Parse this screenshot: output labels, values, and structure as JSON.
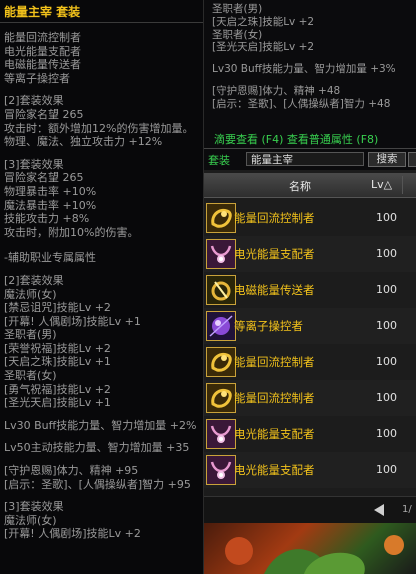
{
  "tooltip": {
    "title": "能量主宰  套装",
    "lines": [
      {
        "text": "能量回流控制者",
        "color": "#9a9a9a",
        "gap": 0
      },
      {
        "text": "电光能量支配者",
        "color": "#9a9a9a",
        "gap": 0
      },
      {
        "text": "电磁能量传送者",
        "color": "#9a9a9a",
        "gap": 0
      },
      {
        "text": "等离子操控者",
        "color": "#9a9a9a",
        "gap": 0
      },
      {
        "text": "[2]套装效果",
        "color": "#9a9a9a",
        "gap": 1
      },
      {
        "text": "冒险家名望 265",
        "color": "#9a9a9a",
        "gap": 0
      },
      {
        "text": "攻击时：额外增加12%的伤害增加量。",
        "color": "#9a9a9a",
        "gap": 0
      },
      {
        "text": "物理、魔法、独立攻击力 +12%",
        "color": "#9a9a9a",
        "gap": 0
      },
      {
        "text": "[3]套装效果",
        "color": "#9a9a9a",
        "gap": 1
      },
      {
        "text": "冒险家名望 265",
        "color": "#9a9a9a",
        "gap": 0
      },
      {
        "text": "物理暴击率 +10%",
        "color": "#9a9a9a",
        "gap": 0
      },
      {
        "text": "魔法暴击率 +10%",
        "color": "#9a9a9a",
        "gap": 0
      },
      {
        "text": "技能攻击力 +8%",
        "color": "#9a9a9a",
        "gap": 0
      },
      {
        "text": "攻击时，附加10%的伤害。",
        "color": "#9a9a9a",
        "gap": 0
      },
      {
        "text": "-辅助职业专属属性",
        "color": "#9a9a9a",
        "gap": 2
      },
      {
        "text": "[2]套装效果",
        "color": "#9a9a9a",
        "gap": 1
      },
      {
        "text": "魔法师(女)",
        "color": "#9a9a9a",
        "gap": 0
      },
      {
        "text": "[禁忌诅咒]技能Lv +2",
        "color": "#9a9a9a",
        "gap": 0
      },
      {
        "text": "[开幕! 人偶剧场]技能Lv +1",
        "color": "#9a9a9a",
        "gap": 0
      },
      {
        "text": "圣职者(男)",
        "color": "#9a9a9a",
        "gap": 0
      },
      {
        "text": "[荣誉祝福]技能Lv +2",
        "color": "#9a9a9a",
        "gap": 0
      },
      {
        "text": "[天启之珠]技能Lv +1",
        "color": "#9a9a9a",
        "gap": 0
      },
      {
        "text": "圣职者(女)",
        "color": "#9a9a9a",
        "gap": 0
      },
      {
        "text": "[勇气祝福]技能Lv +2",
        "color": "#9a9a9a",
        "gap": 0
      },
      {
        "text": "[圣光天启]技能Lv +1",
        "color": "#9a9a9a",
        "gap": 0
      },
      {
        "text": "Lv30 Buff技能力量、智力增加量 +2%",
        "color": "#9a9a9a",
        "gap": 1
      },
      {
        "text": "Lv50主动技能力量、智力增加量 +35",
        "color": "#9a9a9a",
        "gap": 1
      },
      {
        "text": "[守护恩赐]体力、精神 +95",
        "color": "#9a9a9a",
        "gap": 1
      },
      {
        "text": "[启示：圣歌]、[人偶操纵者]智力 +95",
        "color": "#9a9a9a",
        "gap": 0
      },
      {
        "text": "[3]套装效果",
        "color": "#9a9a9a",
        "gap": 1
      },
      {
        "text": "魔法师(女)",
        "color": "#9a9a9a",
        "gap": 0
      },
      {
        "text": "[开幕! 人偶剧场]技能Lv +2",
        "color": "#9a9a9a",
        "gap": 0
      }
    ]
  },
  "right_panel": {
    "lines": [
      {
        "text": "圣职者(男)",
        "gap": 0
      },
      {
        "text": "[天启之珠]技能Lv +2",
        "gap": 0
      },
      {
        "text": "圣职者(女)",
        "gap": 0
      },
      {
        "text": "[圣光天启]技能Lv +2",
        "gap": 0
      },
      {
        "text": "Lv30 Buff技能力量、智力增加量 +3%",
        "gap": 1
      },
      {
        "text": "[守护恩赐]体力、精神 +48",
        "gap": 1
      },
      {
        "text": "[启示：圣歌]、[人偶操纵者]智力 +48",
        "gap": 0
      }
    ],
    "detail_link": "滴要查看 (F4) 查看普通属性 (F8)",
    "set_label": "套装",
    "set_input_value": "能量主宰",
    "search_label": "搜索",
    "list_header": {
      "name": "名称",
      "level": "Lv△"
    },
    "items": [
      {
        "name": "能量回流控制者",
        "level": "100",
        "icon": "gold-bracelet-icon"
      },
      {
        "name": "电光能量支配者",
        "level": "100",
        "icon": "pink-necklace-icon"
      },
      {
        "name": "电磁能量传送者",
        "level": "100",
        "icon": "gold-ring-icon"
      },
      {
        "name": "等离子操控者",
        "level": "100",
        "icon": "purple-orb-icon"
      },
      {
        "name": "能量回流控制者",
        "level": "100",
        "icon": "gold-bracelet-icon"
      },
      {
        "name": "能量回流控制者",
        "level": "100",
        "icon": "gold-bracelet-icon"
      },
      {
        "name": "电光能量支配者",
        "level": "100",
        "icon": "pink-necklace-icon"
      },
      {
        "name": "电光能量支配者",
        "level": "100",
        "icon": "pink-necklace-icon"
      }
    ],
    "page_indicator": "1/"
  },
  "colors": {
    "gold": "#f2c21b",
    "green": "#38d04f",
    "gray": "#9a9a9a"
  }
}
